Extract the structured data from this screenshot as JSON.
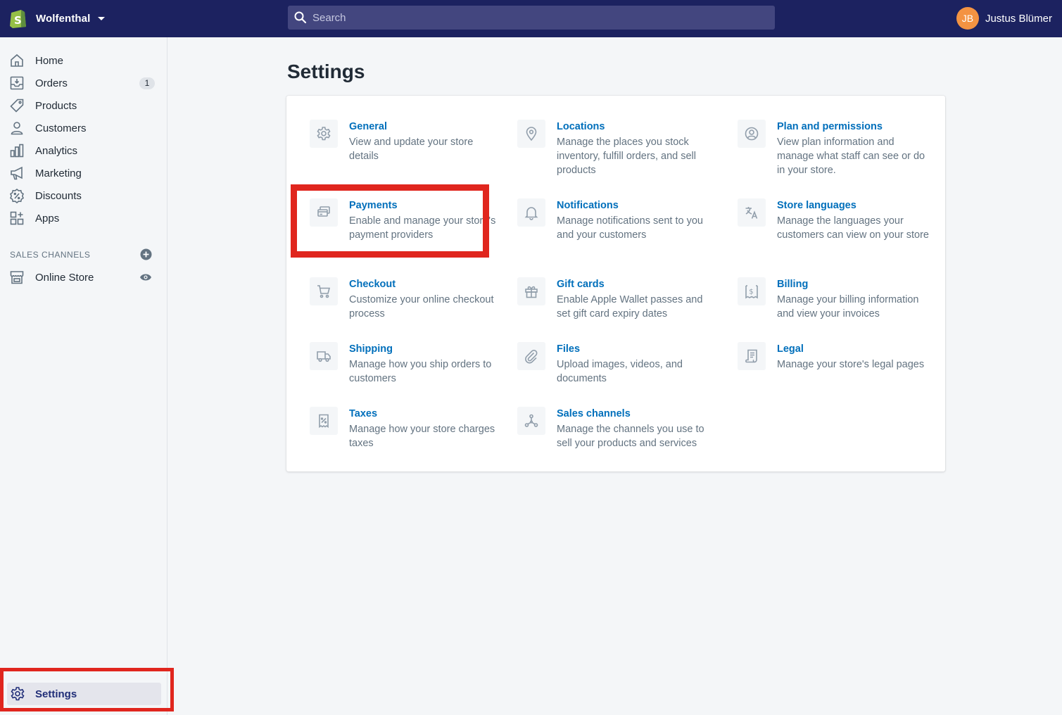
{
  "topbar": {
    "store_name": "Wolfenthal",
    "search_placeholder": "Search",
    "user_initials": "JB",
    "user_name": "Justus Blümer"
  },
  "sidebar": {
    "items": [
      {
        "label": "Home",
        "icon": "home-icon"
      },
      {
        "label": "Orders",
        "icon": "orders-icon",
        "badge": "1"
      },
      {
        "label": "Products",
        "icon": "tag-icon"
      },
      {
        "label": "Customers",
        "icon": "customer-icon"
      },
      {
        "label": "Analytics",
        "icon": "analytics-icon"
      },
      {
        "label": "Marketing",
        "icon": "megaphone-icon"
      },
      {
        "label": "Discounts",
        "icon": "discount-icon"
      },
      {
        "label": "Apps",
        "icon": "apps-icon"
      }
    ],
    "sales_channels_heading": "SALES CHANNELS",
    "online_store": "Online Store",
    "settings": "Settings"
  },
  "main": {
    "title": "Settings",
    "tiles": [
      {
        "title": "General",
        "desc": "View and update your store details",
        "icon": "gear-icon"
      },
      {
        "title": "Locations",
        "desc": "Manage the places you stock inventory, fulfill orders, and sell products",
        "icon": "location-pin-icon"
      },
      {
        "title": "Plan and permissions",
        "desc": "View plan information and manage what staff can see or do in your store.",
        "icon": "user-circle-icon"
      },
      {
        "title": "Payments",
        "desc": "Enable and manage your store's payment providers",
        "icon": "payments-icon"
      },
      {
        "title": "Notifications",
        "desc": "Manage notifications sent to you and your customers",
        "icon": "bell-icon"
      },
      {
        "title": "Store languages",
        "desc": "Manage the languages your customers can view on your store",
        "icon": "translate-icon"
      },
      {
        "title": "Checkout",
        "desc": "Customize your online checkout process",
        "icon": "cart-icon"
      },
      {
        "title": "Gift cards",
        "desc": "Enable Apple Wallet passes and set gift card expiry dates",
        "icon": "gift-icon"
      },
      {
        "title": "Billing",
        "desc": "Manage your billing information and view your invoices",
        "icon": "billing-icon"
      },
      {
        "title": "Shipping",
        "desc": "Manage how you ship orders to customers",
        "icon": "truck-icon"
      },
      {
        "title": "Files",
        "desc": "Upload images, videos, and documents",
        "icon": "paperclip-icon"
      },
      {
        "title": "Legal",
        "desc": "Manage your store's legal pages",
        "icon": "legal-icon"
      },
      {
        "title": "Taxes",
        "desc": "Manage how your store charges taxes",
        "icon": "taxes-icon"
      },
      {
        "title": "Sales channels",
        "desc": "Manage the channels you use to sell your products and services",
        "icon": "channels-icon"
      }
    ]
  },
  "colors": {
    "topbar": "#1c2260",
    "link": "#006fbb",
    "highlight": "#e0261e",
    "avatar": "#f49342"
  }
}
